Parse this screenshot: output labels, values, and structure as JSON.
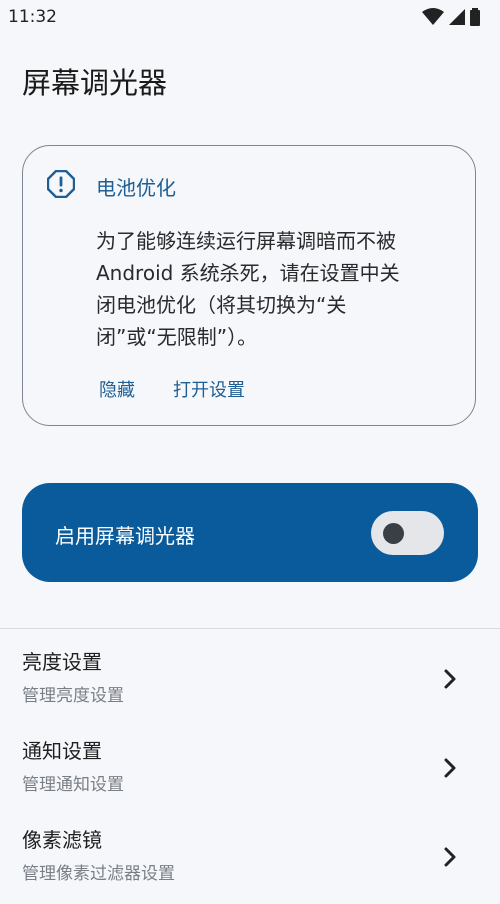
{
  "status_bar": {
    "time": "11:32",
    "icons": [
      "wifi-icon",
      "signal-icon",
      "battery-icon"
    ]
  },
  "page": {
    "title": "屏幕调光器"
  },
  "battery_card": {
    "icon": "warning-icon",
    "title": "电池优化",
    "body": "为了能够连续运行屏幕调暗而不被\nAndroid 系统杀死，请在设置中关\n闭电池优化（将其切换为“关\n闭”或“无限制”）。",
    "hide_label": "隐藏",
    "open_settings_label": "打开设置"
  },
  "enable_card": {
    "label": "启用屏幕调光器",
    "enabled": false
  },
  "settings": [
    {
      "title": "亮度设置",
      "subtitle": "管理亮度设置"
    },
    {
      "title": "通知设置",
      "subtitle": "管理通知设置"
    },
    {
      "title": "像素滤镜",
      "subtitle": "管理像素过滤器设置"
    }
  ],
  "colors": {
    "accent": "#1f5f93",
    "primary_card": "#0a5b9b",
    "background": "#f5f7fb"
  }
}
